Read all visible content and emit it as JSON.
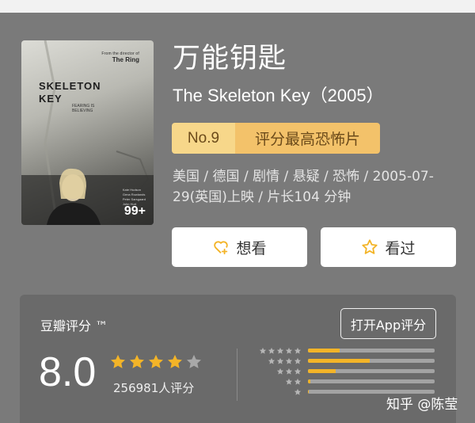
{
  "movie": {
    "title_cn": "万能钥匙",
    "title_en": "The Skeleton Key（2005）",
    "rank_no": "No.9",
    "rank_text": "评分最高恐怖片",
    "meta": "美国 / 德国 / 剧情 / 悬疑 / 恐怖 / 2005-07-29(英国)上映 / 片长104 分钟"
  },
  "poster": {
    "tag_small": "From the director of",
    "tag_ring": "The Ring",
    "title_line1": "SKELETON",
    "title_line2": "KEY",
    "tagline_line1": "FEARING IS",
    "tagline_line2": "BELIEVING",
    "credits": [
      "Kate Hudson",
      "Gena Rowlands",
      "Peter Sarsgaard",
      "John Hurt"
    ],
    "badge": "99+"
  },
  "actions": {
    "want_label": "想看",
    "seen_label": "看过"
  },
  "rating": {
    "label": "豆瓣评分 ™",
    "app_button": "打开App评分",
    "score": "8.0",
    "stars_filled": 4,
    "stars_total": 5,
    "count_text": "256981人评分",
    "distribution": [
      {
        "stars": 5,
        "fraction": 0.25
      },
      {
        "stars": 4,
        "fraction": 0.49
      },
      {
        "stars": 3,
        "fraction": 0.22
      },
      {
        "stars": 2,
        "fraction": 0.02
      },
      {
        "stars": 1,
        "fraction": 0.005
      }
    ]
  },
  "watermark": "知乎 @陈莹",
  "colors": {
    "background": "#7a7a7a",
    "panel": "#6a6a6a",
    "star": "#f3b428",
    "rank_no_bg": "#f7d78a",
    "rank_text_bg": "#f3c26a"
  },
  "icons": {
    "want": "heart-plus-icon",
    "seen": "star-outline-icon"
  }
}
